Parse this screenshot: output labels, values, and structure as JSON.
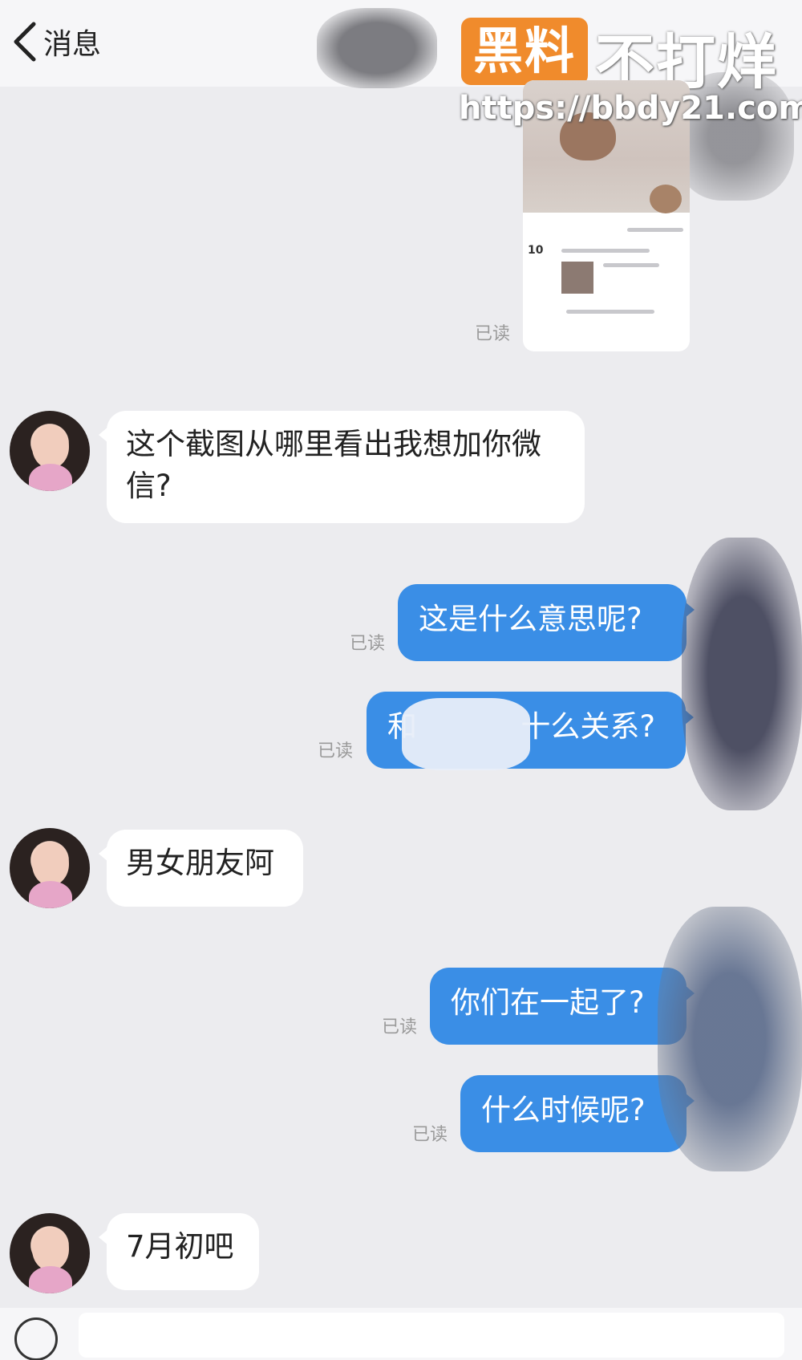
{
  "header": {
    "back_label": "消息"
  },
  "watermark": {
    "badge": "黑料",
    "text": "不打烊",
    "url": "https://bbdy21.com"
  },
  "read_label": "已读",
  "messages": [
    {
      "side": "left",
      "text": "这个截图从哪里看出我想加你微\n信?"
    },
    {
      "side": "right",
      "text": "这是什么意思呢?"
    },
    {
      "side": "right",
      "text": "和           十么关系?"
    },
    {
      "side": "left",
      "text": "男女朋友阿"
    },
    {
      "side": "right",
      "text": "你们在一起了?"
    },
    {
      "side": "right",
      "text": "什么时候呢?"
    },
    {
      "side": "left",
      "text": "7月初吧"
    }
  ],
  "thumbnail": {
    "number": "10"
  },
  "colors": {
    "accent_blue": "#3a8ee6",
    "watermark_orange": "#f08b2c",
    "background": "#ececef"
  }
}
